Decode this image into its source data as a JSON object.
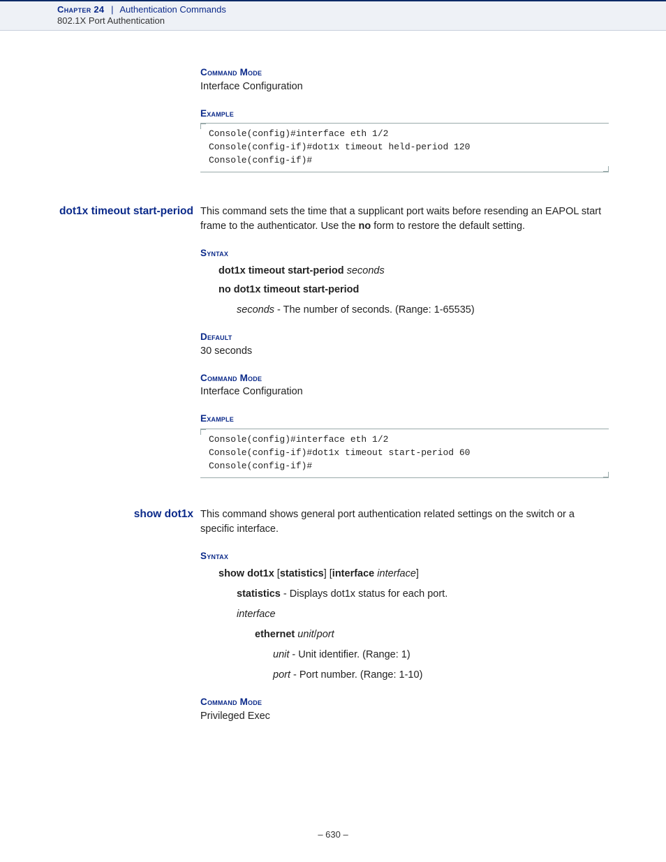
{
  "header": {
    "chapter_label": "Chapter 24",
    "separator": "|",
    "chapter_title": "Authentication Commands",
    "subsection": "802.1X Port Authentication"
  },
  "sec0": {
    "command_mode_label": "Command Mode",
    "command_mode_value": "Interface Configuration",
    "example_label": "Example",
    "example_code": "Console(config)#interface eth 1/2\nConsole(config-if)#dot1x timeout held-period 120\nConsole(config-if)#"
  },
  "sec1": {
    "name": "dot1x timeout start-period",
    "desc_prefix": "This command sets the time that a supplicant port waits before resending an EAPOL start frame to the authenticator. Use the ",
    "desc_bold": "no",
    "desc_suffix": " form to restore the default setting.",
    "syntax_label": "Syntax",
    "syntax_line1_cmd": "dot1x timeout start-period",
    "syntax_line1_arg": "seconds",
    "syntax_line2_cmd": "no dot1x timeout start-period",
    "syntax_param_name": "seconds",
    "syntax_param_desc": " - The number of seconds. (Range: 1-65535)",
    "default_label": "Default",
    "default_value": "30 seconds",
    "command_mode_label": "Command Mode",
    "command_mode_value": "Interface Configuration",
    "example_label": "Example",
    "example_code": "Console(config)#interface eth 1/2\nConsole(config-if)#dot1x timeout start-period 60\nConsole(config-if)#"
  },
  "sec2": {
    "name": "show dot1x",
    "desc": "This command shows general port authentication related settings on the switch or a specific interface.",
    "syntax_label": "Syntax",
    "syn_cmd": "show dot1x",
    "syn_b1": "[",
    "syn_kw1": "statistics",
    "syn_b2": "] [",
    "syn_kw2": "interface",
    "syn_sp": " ",
    "syn_arg2": "interface",
    "syn_b3": "]",
    "p_statistics_name": "statistics",
    "p_statistics_desc": " - Displays dot1x status for each port.",
    "p_interface_name": "interface",
    "p_ethernet_kw": "ethernet",
    "p_ethernet_arg1": "unit",
    "p_ethernet_slash": "/",
    "p_ethernet_arg2": "port",
    "p_unit_name": "unit",
    "p_unit_desc": " - Unit identifier. (Range: 1)",
    "p_port_name": "port",
    "p_port_desc": " - Port number. (Range: 1-10)",
    "command_mode_label": "Command Mode",
    "command_mode_value": "Privileged Exec"
  },
  "page_number": "–  630  –"
}
